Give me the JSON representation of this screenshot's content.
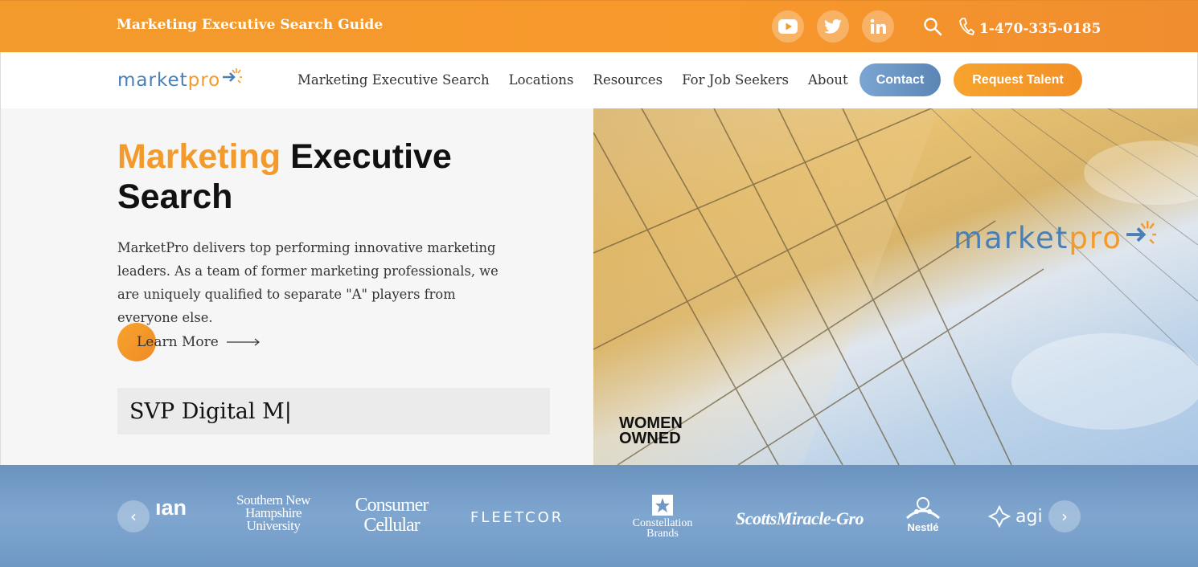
{
  "topbar": {
    "guide_link": "Marketing Executive Search Guide",
    "social": [
      {
        "icon": "youtube-icon"
      },
      {
        "icon": "twitter-icon"
      },
      {
        "icon": "linkedin-icon"
      }
    ],
    "phone": "1-470-335-0185"
  },
  "logo": {
    "part1": "market",
    "part2": "pro"
  },
  "nav": {
    "links": [
      "Marketing Executive Search",
      "Locations",
      "Resources",
      "For Job Seekers",
      "About"
    ],
    "contact_label": "Contact",
    "request_label": "Request Talent"
  },
  "hero": {
    "title_accent": "Marketing",
    "title_rest": "Executive",
    "title_line2": "Search",
    "description": "MarketPro delivers top performing innovative marketing leaders. As a team of former marketing professionals, we are uniquely qualified to separate \"A\" players from everyone else.",
    "learn_more": "Learn More",
    "typing_text": "SVP Digital M|",
    "badge_line1": "WOMEN",
    "badge_line2": "OWNED"
  },
  "clients": {
    "logos": [
      "ıan",
      "Southern New Hampshire University",
      "Consumer Cellular",
      "FLEETCOR",
      "Constellation Brands",
      "ScottsMiracle-Gro",
      "Nestlé",
      "agi"
    ],
    "prev": "‹",
    "next": "›"
  },
  "colors": {
    "orange": "#f39a2c",
    "blue": "#4a7fb5",
    "strip": "#7fa6cf"
  }
}
